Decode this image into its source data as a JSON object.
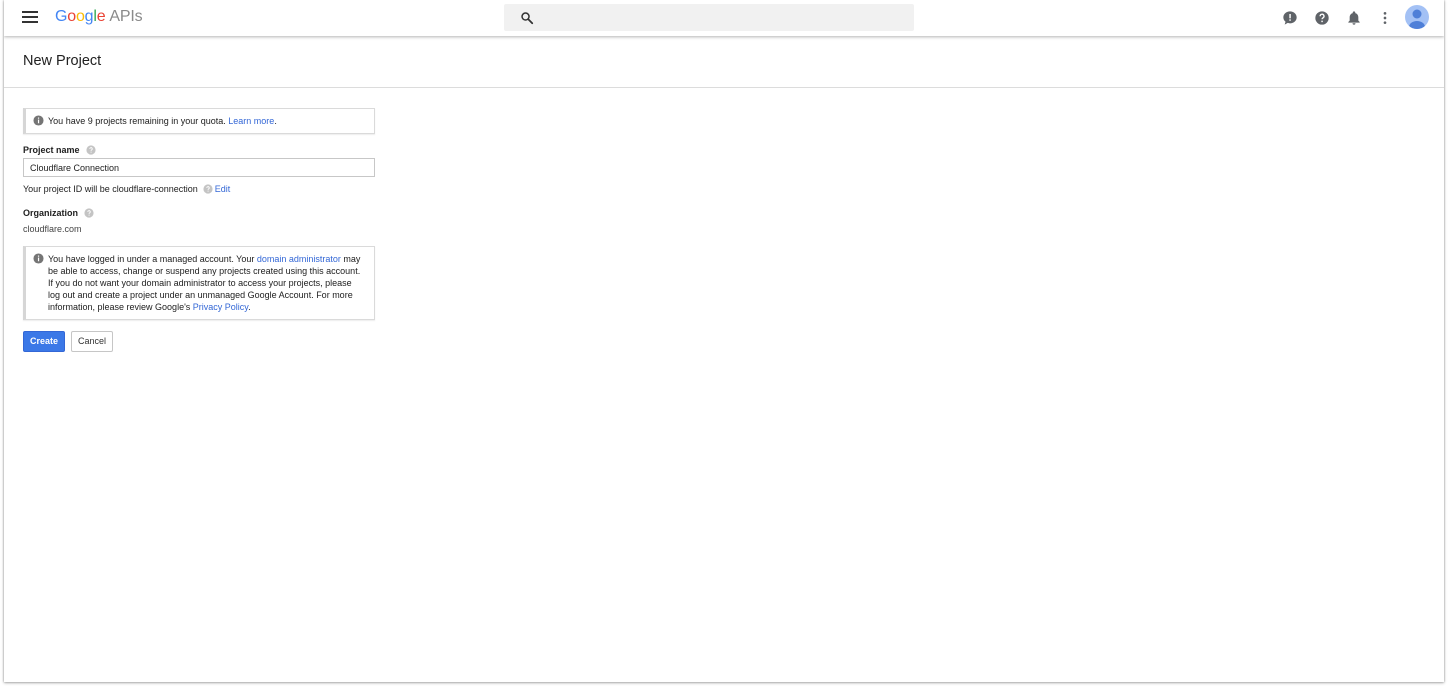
{
  "topbar": {
    "logo_letters": [
      "G",
      "o",
      "o",
      "g",
      "l",
      "e"
    ],
    "logo_suffix": "APIs",
    "search": {
      "placeholder": "",
      "icon": "search-icon"
    },
    "icons": [
      "feedback-icon",
      "help-icon",
      "notifications-icon",
      "more-vert-icon",
      "avatar"
    ]
  },
  "page": {
    "title": "New Project"
  },
  "quota": {
    "text": "You have 9 projects remaining in your quota. ",
    "link": "Learn more",
    "suffix": "."
  },
  "project_name": {
    "label": "Project name",
    "value": "Cloudflare Connection",
    "id_text": "Your project ID will be cloudflare-connection",
    "edit_link": "Edit"
  },
  "organization": {
    "label": "Organization",
    "value": "cloudflare.com"
  },
  "managed_notice": {
    "text1": "You have logged in under a managed account. Your ",
    "link1": "domain administrator",
    "text2": " may be able to access, change or suspend any projects created using this account. If you do not want your domain administrator to access your projects, please log out and create a project under an unmanaged Google Account. For more information, please review Google's ",
    "link2": "Privacy Policy",
    "text3": "."
  },
  "actions": {
    "create": "Create",
    "cancel": "Cancel"
  },
  "colors": {
    "accent": "#3b78e7",
    "link": "#3367d6"
  }
}
